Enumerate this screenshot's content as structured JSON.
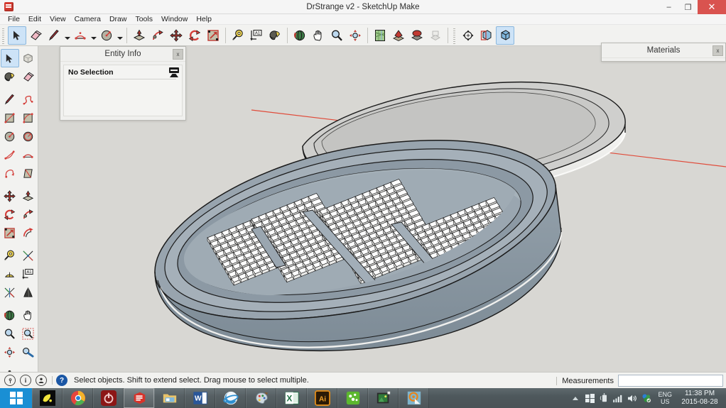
{
  "window": {
    "title": "DrStrange v2 - SketchUp Make",
    "app_logo_name": "sketchup-logo",
    "minimize": "–",
    "maximize": "❐",
    "close": "✕"
  },
  "menubar": {
    "items": [
      {
        "label": "File"
      },
      {
        "label": "Edit"
      },
      {
        "label": "View"
      },
      {
        "label": "Camera"
      },
      {
        "label": "Draw"
      },
      {
        "label": "Tools"
      },
      {
        "label": "Window"
      },
      {
        "label": "Help"
      }
    ]
  },
  "toolbar_top": {
    "groups": [
      {
        "buttons": [
          {
            "name": "select-tool",
            "icon": "arrow-cursor-icon",
            "active": true
          },
          {
            "name": "make-component-tool",
            "icon": "component-box-icon",
            "active": false
          },
          {
            "name": "eraser-tool",
            "icon": "eraser-icon",
            "active": false
          },
          {
            "name": "line-tool",
            "icon": "pencil-icon",
            "active": false,
            "dropdown": true
          },
          {
            "name": "arc-tool",
            "icon": "arc-icon",
            "active": false,
            "dropdown": true
          },
          {
            "name": "circle-tool",
            "icon": "circle-icon",
            "active": false,
            "dropdown": true
          }
        ]
      },
      {
        "buttons": [
          {
            "name": "push-pull-tool",
            "icon": "push-pull-icon",
            "active": false
          },
          {
            "name": "follow-me-tool",
            "icon": "follow-me-icon",
            "active": false
          },
          {
            "name": "move-tool",
            "icon": "move-cross-icon",
            "active": false
          },
          {
            "name": "rotate-tool",
            "icon": "rotate-arrows-icon",
            "active": false
          },
          {
            "name": "scale-tool",
            "icon": "scale-box-icon",
            "active": false
          }
        ]
      },
      {
        "buttons": [
          {
            "name": "tape-measure-tool",
            "icon": "tape-measure-icon",
            "active": false
          },
          {
            "name": "dimension-tool",
            "icon": "dimension-a1-icon",
            "active": false
          },
          {
            "name": "paint-bucket-tool",
            "icon": "paint-bucket-icon",
            "active": false
          }
        ]
      },
      {
        "buttons": [
          {
            "name": "orbit-tool",
            "icon": "orbit-icon",
            "active": false
          },
          {
            "name": "pan-tool",
            "icon": "hand-icon",
            "active": false
          },
          {
            "name": "zoom-tool",
            "icon": "magnifier-icon",
            "active": false
          },
          {
            "name": "zoom-extents-tool",
            "icon": "zoom-extents-icon",
            "active": false
          }
        ]
      },
      {
        "buttons": [
          {
            "name": "add-location-tool",
            "icon": "map-location-icon",
            "active": false
          },
          {
            "name": "toggle-terrain-tool",
            "icon": "terrain-toggle-icon",
            "active": false
          },
          {
            "name": "photo-texture-tool",
            "icon": "photo-texture-icon",
            "active": false
          },
          {
            "name": "model-info-tool",
            "icon": "model-info-icon",
            "active": false,
            "disabled": true
          }
        ]
      },
      {
        "buttons": [
          {
            "name": "section-plane-tool",
            "icon": "section-plane-icon",
            "active": false
          },
          {
            "name": "display-section-planes-tool",
            "icon": "display-section-icon",
            "active": false
          },
          {
            "name": "display-section-cuts-tool",
            "icon": "section-cut-icon",
            "active": true
          }
        ]
      }
    ]
  },
  "toolbar_left": {
    "groups": [
      {
        "rows": [
          [
            {
              "name": "select-tool",
              "icon": "arrow-cursor-icon",
              "active": true
            },
            {
              "name": "make-component-tool",
              "icon": "component-box-icon",
              "active": false
            }
          ],
          [
            {
              "name": "paint-bucket-tool",
              "icon": "paint-bucket-icon",
              "active": false
            },
            {
              "name": "eraser-tool",
              "icon": "eraser-icon",
              "active": false
            }
          ]
        ]
      },
      {
        "rows": [
          [
            {
              "name": "line-tool",
              "icon": "pencil-icon",
              "active": false
            },
            {
              "name": "freehand-tool",
              "icon": "freehand-squiggle-icon",
              "active": false
            }
          ],
          [
            {
              "name": "rectangle-tool",
              "icon": "rectangle-icon",
              "active": false
            },
            {
              "name": "rotated-rectangle-tool",
              "icon": "rotated-rectangle-icon",
              "active": false
            }
          ],
          [
            {
              "name": "circle-tool",
              "icon": "circle-icon",
              "active": false
            },
            {
              "name": "polygon-tool",
              "icon": "polygon-icon",
              "active": false
            }
          ],
          [
            {
              "name": "arc-tool",
              "icon": "arc-2point-icon",
              "active": false
            },
            {
              "name": "pie-tool",
              "icon": "pie-arc-icon",
              "active": false
            }
          ],
          [
            {
              "name": "arc-3point-tool",
              "icon": "arc-3point-icon",
              "active": false
            },
            {
              "name": "sandbox-tool",
              "icon": "sandbox-icon",
              "active": false
            }
          ]
        ]
      },
      {
        "rows": [
          [
            {
              "name": "move-tool",
              "icon": "move-cross-icon",
              "active": false
            },
            {
              "name": "push-pull-tool",
              "icon": "push-pull-icon",
              "active": false
            }
          ],
          [
            {
              "name": "rotate-tool",
              "icon": "rotate-arrows-icon",
              "active": false
            },
            {
              "name": "follow-me-tool",
              "icon": "follow-me-icon",
              "active": false
            }
          ],
          [
            {
              "name": "scale-tool",
              "icon": "scale-box-icon",
              "active": false
            },
            {
              "name": "offset-tool",
              "icon": "offset-icon",
              "active": false
            }
          ]
        ]
      },
      {
        "rows": [
          [
            {
              "name": "tape-measure-tool",
              "icon": "tape-measure-icon",
              "active": false
            },
            {
              "name": "protractor-tool",
              "icon": "protractor-icon",
              "active": false
            }
          ],
          [
            {
              "name": "axes-tool",
              "icon": "axes-icon",
              "active": false
            },
            {
              "name": "dimension-tool",
              "icon": "dimension-a1-icon",
              "active": false
            }
          ],
          [
            {
              "name": "text-tool",
              "icon": "text-3d-icon",
              "active": false
            },
            {
              "name": "three-d-text-tool",
              "icon": "cone-text-icon",
              "active": false
            }
          ]
        ]
      },
      {
        "rows": [
          [
            {
              "name": "orbit-tool",
              "icon": "orbit-icon",
              "active": false
            },
            {
              "name": "pan-tool",
              "icon": "hand-icon",
              "active": false
            }
          ],
          [
            {
              "name": "zoom-tool",
              "icon": "magnifier-icon",
              "active": false
            },
            {
              "name": "zoom-window-tool",
              "icon": "zoom-window-icon",
              "active": false
            }
          ],
          [
            {
              "name": "zoom-extents-tool",
              "icon": "zoom-extents-icon",
              "active": false
            },
            {
              "name": "previous-view-tool",
              "icon": "previous-view-icon",
              "active": false
            }
          ]
        ]
      },
      {
        "rows": [
          [
            {
              "name": "walk-tool",
              "icon": "walk-person-icon",
              "active": false
            },
            {
              "name": "look-around-tool",
              "icon": "eye-icon",
              "active": false
            }
          ]
        ]
      }
    ]
  },
  "panels": {
    "entity_info": {
      "title": "Entity Info",
      "close_label": "x",
      "selection_text": "No Selection",
      "detail_icon": "entity-detail-icon"
    },
    "materials": {
      "title": "Materials",
      "close_label": "x"
    }
  },
  "canvas": {
    "background_color": "#d8d7d3",
    "model_name": "oval-case-with-block-grid",
    "axis_line_color": "#e04b3a",
    "case_body_color": "#8e9aa4",
    "case_rim_color": "#a8b3bb",
    "case_inner_color": "#9aa6b0",
    "lid_top_color": "#cfcfcd",
    "lid_side_color": "#f2f2f0",
    "block_face_color": "#ffffff",
    "block_shade_color": "#d6d6d4",
    "outline_color": "#1a1a1a"
  },
  "statusbar": {
    "icons": [
      {
        "name": "geo-location-icon",
        "glyph": "♀"
      },
      {
        "name": "info-icon",
        "glyph": "i"
      },
      {
        "name": "user-account-icon",
        "glyph": "☺"
      }
    ],
    "help_icon": "help-question-icon",
    "help_glyph": "?",
    "hint_text": "Select objects. Shift to extend select. Drag mouse to select multiple.",
    "measurements_label": "Measurements",
    "measurements_value": "",
    "measurements_placeholder": ""
  },
  "taskbar": {
    "start": {
      "name": "start-button",
      "icon": "windows-logo-icon"
    },
    "items": [
      {
        "name": "taskbar-item-media-app",
        "icon": "yellow-comet-icon",
        "running": false
      },
      {
        "name": "taskbar-item-chrome",
        "icon": "chrome-icon",
        "running": false
      },
      {
        "name": "taskbar-item-power",
        "icon": "power-button-icon",
        "running": false
      },
      {
        "name": "taskbar-item-sketchup",
        "icon": "sketchup-icon",
        "running": true
      },
      {
        "name": "taskbar-item-file-explorer",
        "icon": "folder-explorer-icon",
        "running": false
      },
      {
        "name": "taskbar-item-word",
        "icon": "word-icon",
        "running": false
      },
      {
        "name": "taskbar-item-internet-explorer",
        "icon": "ie-icon",
        "running": false
      },
      {
        "name": "taskbar-item-paint",
        "icon": "paint-palette-icon",
        "running": false
      },
      {
        "name": "taskbar-item-excel",
        "icon": "excel-icon",
        "running": false
      },
      {
        "name": "taskbar-item-illustrator",
        "icon": "illustrator-ai-icon",
        "running": false
      },
      {
        "name": "taskbar-item-green-app",
        "icon": "green-puzzle-icon",
        "running": false
      },
      {
        "name": "taskbar-item-image-viewer",
        "icon": "image-viewer-icon",
        "running": false
      },
      {
        "name": "taskbar-item-orange-app",
        "icon": "orange-target-icon",
        "running": false
      }
    ],
    "tray": {
      "show_hidden_icons": "show-hidden-icons-arrow",
      "icons": [
        {
          "name": "tray-windows-icon",
          "glyph": "⊞"
        },
        {
          "name": "tray-flash-icon",
          "glyph": "⌁"
        },
        {
          "name": "tray-network-icon",
          "glyph": "▢"
        },
        {
          "name": "tray-volume-icon",
          "glyph": "◀"
        },
        {
          "name": "tray-antivirus-icon",
          "glyph": "♻"
        }
      ],
      "language_line1": "ENG",
      "language_line2": "US",
      "time": "11:38 PM",
      "date": "2015-08-28"
    }
  }
}
